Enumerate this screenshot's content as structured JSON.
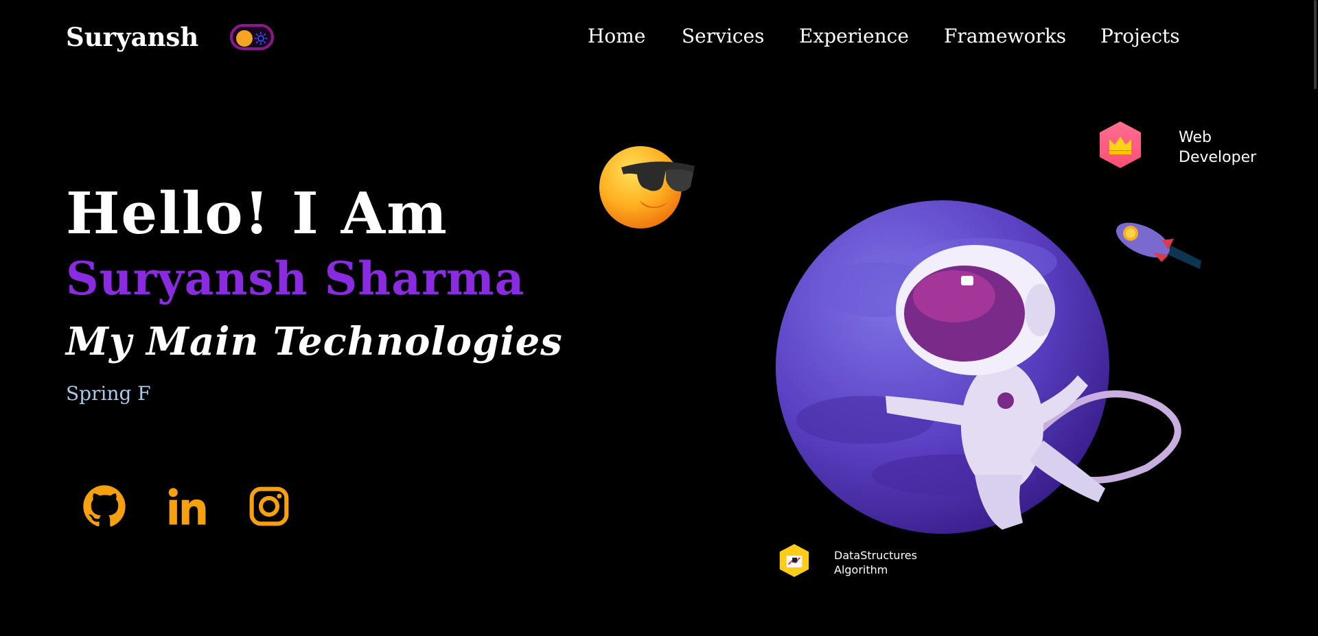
{
  "header": {
    "brand": "Suryansh",
    "theme_toggle": "dark",
    "nav": [
      {
        "label": "Home"
      },
      {
        "label": "Services"
      },
      {
        "label": "Experience"
      },
      {
        "label": "Frameworks"
      },
      {
        "label": "Projects"
      }
    ]
  },
  "hero": {
    "greeting": "Hello! I Am",
    "name": "Suryansh Sharma",
    "subtitle": "My Main Technologies",
    "typed_text": "Spring F"
  },
  "socials": [
    {
      "icon": "github-icon"
    },
    {
      "icon": "linkedin-icon"
    },
    {
      "icon": "instagram-icon"
    }
  ],
  "badges": {
    "web": {
      "line1": "Web",
      "line2": "Developer",
      "icon": "crown-icon"
    },
    "dsa": {
      "line1": "DataStructures",
      "line2": "Algorithm",
      "icon": "chart-icon"
    }
  },
  "colors": {
    "accent_purple": "#8a2be2",
    "social_orange": "#f5a00f",
    "typed_blue": "#a9c8ea",
    "background": "#000000"
  }
}
